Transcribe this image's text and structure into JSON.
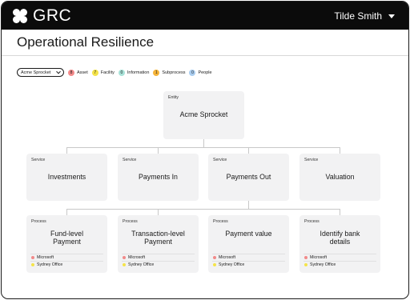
{
  "app": {
    "name": "GRC"
  },
  "header": {
    "user_name": "Tilde Smith"
  },
  "page": {
    "title": "Operational Resilience"
  },
  "filters": {
    "entity_select": "Acme Sprocket",
    "legend": [
      {
        "count": "8",
        "label": "Asset",
        "color": "#f28a8a"
      },
      {
        "count": "7",
        "label": "Facility",
        "color": "#f4e34a"
      },
      {
        "count": "0",
        "label": "Information",
        "color": "#a8e2d8"
      },
      {
        "count": "1",
        "label": "Subprocess",
        "color": "#f5b43a"
      },
      {
        "count": "0",
        "label": "People",
        "color": "#a9cdf0"
      }
    ]
  },
  "tree": {
    "entity": {
      "kind": "Entity",
      "name": "Acme Sprocket"
    },
    "services": [
      {
        "kind": "Service",
        "name": "Investments"
      },
      {
        "kind": "Service",
        "name": "Payments In"
      },
      {
        "kind": "Service",
        "name": "Payments Out"
      },
      {
        "kind": "Service",
        "name": "Valuation"
      }
    ],
    "processes": [
      {
        "kind": "Process",
        "name_line1": "Fund-level",
        "name_line2": "Payment",
        "links": [
          {
            "label": "Microsoft",
            "color": "#f28a8a"
          },
          {
            "label": "Sydney Office",
            "color": "#f4e34a"
          }
        ]
      },
      {
        "kind": "Process",
        "name_line1": "Transaction-level",
        "name_line2": "Payment",
        "links": [
          {
            "label": "Microsoft",
            "color": "#f28a8a"
          },
          {
            "label": "Sydney Office",
            "color": "#f4e34a"
          }
        ]
      },
      {
        "kind": "Process",
        "name_line1": "Payment value",
        "name_line2": "",
        "links": [
          {
            "label": "Microsoft",
            "color": "#f28a8a"
          },
          {
            "label": "Sydney Office",
            "color": "#f4e34a"
          }
        ]
      },
      {
        "kind": "Process",
        "name_line1": "Identify bank",
        "name_line2": "details",
        "links": [
          {
            "label": "Microsoft",
            "color": "#f28a8a"
          },
          {
            "label": "Sydney Office",
            "color": "#f4e34a"
          }
        ]
      }
    ]
  }
}
